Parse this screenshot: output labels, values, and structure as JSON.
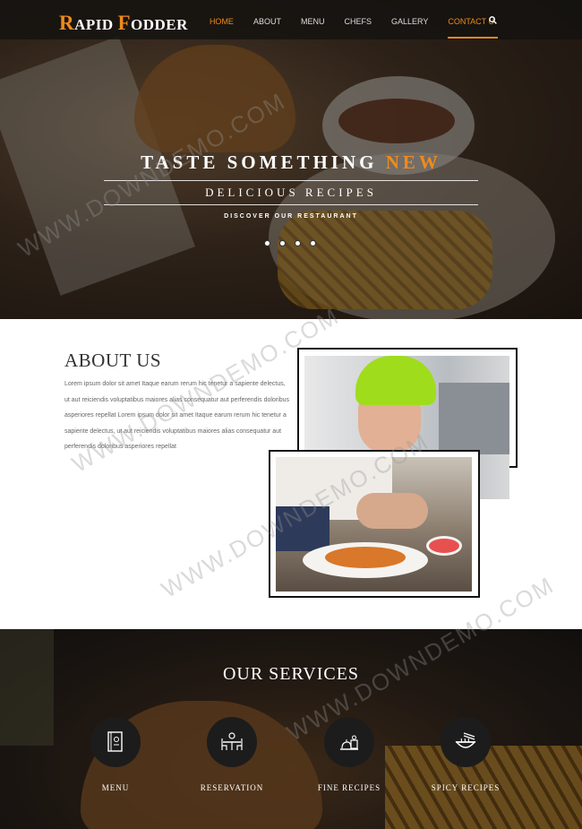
{
  "nav": {
    "logo": {
      "r": "R",
      "apid": "APID ",
      "f": "F",
      "odder": "ODDER"
    },
    "items": [
      {
        "label": "HOME"
      },
      {
        "label": "ABOUT"
      },
      {
        "label": "MENU"
      },
      {
        "label": "CHEFS"
      },
      {
        "label": "GALLERY"
      },
      {
        "label": "CONTACT U"
      }
    ],
    "active": "HOME",
    "search_icon": "search-icon"
  },
  "hero": {
    "title_main": "TASTE SOMETHING ",
    "title_accent": "NEW",
    "subtitle": "DELICIOUS RECIPES",
    "tagline": "DISCOVER OUR RESTAURANT",
    "slides": 4
  },
  "about": {
    "title": "ABOUT US",
    "text": "Lorem ipsum dolor sit amet Itaque earum rerum hic tenetur a sapiente delectus, ut aut reiciendis voluptatibus maiores alias consequatur aut perferendis doloribus asperiores repellat Lorem ipsum dolor sit amet Itaque earum rerum hic tenetur a sapiente delectus, ut aut reiciendis voluptatibus maiores alias consequatur aut perferendis doloribus asperiores repellat"
  },
  "services": {
    "title": "OUR SERVICES",
    "items": [
      {
        "label": "MENU",
        "icon": "menu-book-icon"
      },
      {
        "label": "RESERVATION",
        "icon": "reservation-table-icon"
      },
      {
        "label": "FINE RECIPES",
        "icon": "fine-recipes-icon"
      },
      {
        "label": "SPICY RECIPES",
        "icon": "noodle-bowl-icon"
      }
    ]
  },
  "watermark": "WWW.DOWNDEMO.COM",
  "colors": {
    "accent": "#f08a1c",
    "nav_bg": "#141210",
    "text_dark": "#333333"
  }
}
